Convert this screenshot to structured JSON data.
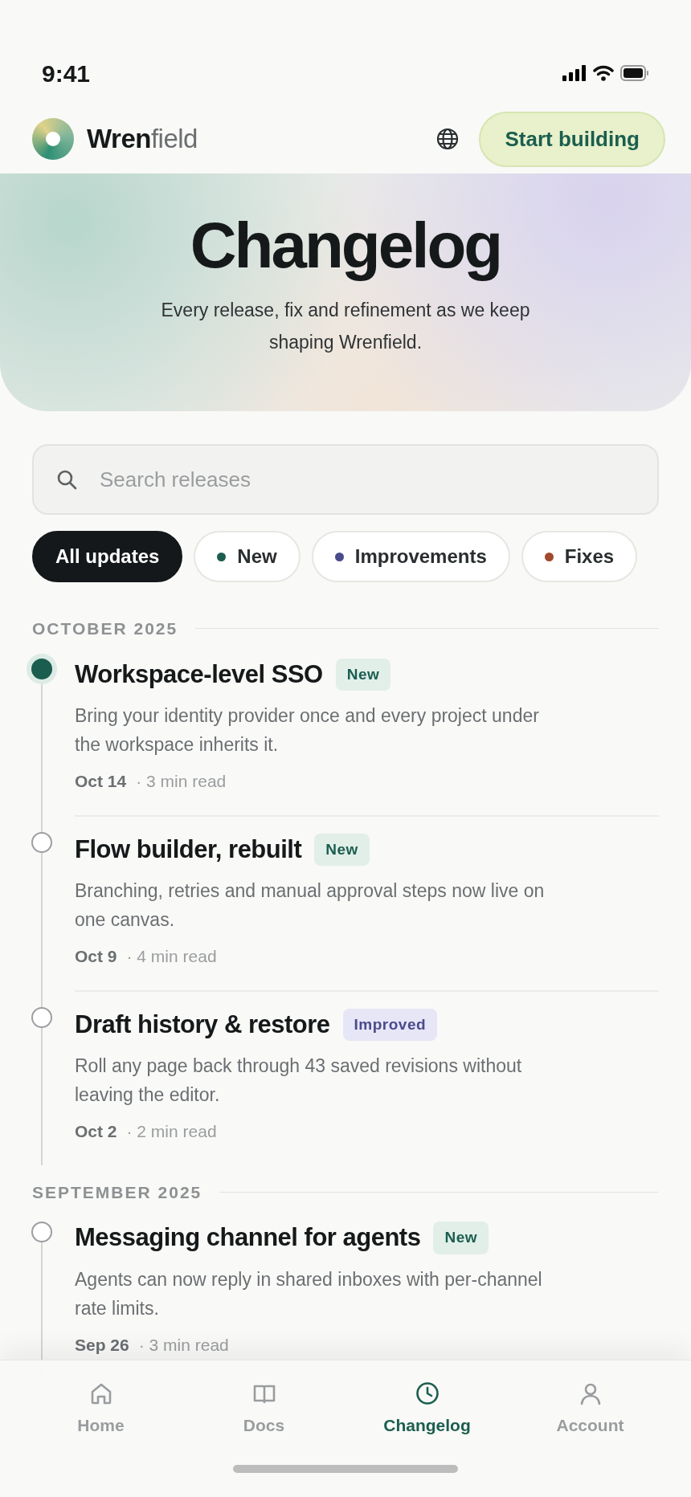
{
  "status_bar": {
    "time": "9:41"
  },
  "header": {
    "brand_bold": "Wren",
    "brand_light": "field",
    "cta": "Start building"
  },
  "hero": {
    "title": "Changelog",
    "subtitle": "Every release, fix and refinement as we keep shaping Wrenfield."
  },
  "search": {
    "placeholder": "Search releases"
  },
  "filters": [
    {
      "label": "All updates",
      "selected": true
    },
    {
      "label": "New",
      "selected": false,
      "color": "#1b5e4f"
    },
    {
      "label": "Improvements",
      "selected": false,
      "color": "#4a4b8c"
    },
    {
      "label": "Fixes",
      "selected": false,
      "color": "#a0492c"
    }
  ],
  "months": [
    {
      "label": "OCTOBER 2025",
      "entries": [
        {
          "title": "Workspace-level SSO",
          "tag": "New",
          "kind": "new",
          "current": true,
          "description": "Bring your identity provider once and every project under the workspace inherits it.",
          "date": "Oct 14",
          "read": "· 3 min read"
        },
        {
          "title": "Flow builder, rebuilt",
          "tag": "New",
          "kind": "new",
          "current": false,
          "description": "Branching, retries and manual approval steps now live on one canvas.",
          "date": "Oct 9",
          "read": "· 4 min read"
        },
        {
          "title": "Draft history & restore",
          "tag": "Improved",
          "kind": "improved",
          "current": false,
          "description": "Roll any page back through 43 saved revisions without leaving the editor.",
          "date": "Oct 2",
          "read": "· 2 min read"
        }
      ]
    },
    {
      "label": "SEPTEMBER 2025",
      "entries": [
        {
          "title": "Messaging channel for agents",
          "tag": "New",
          "kind": "new",
          "current": false,
          "description": "Agents can now reply in shared inboxes with per-channel rate limits.",
          "date": "Sep 26",
          "read": "· 3 min read"
        }
      ]
    }
  ],
  "tab_bar": [
    {
      "label": "Home",
      "selected": false
    },
    {
      "label": "Docs",
      "selected": false
    },
    {
      "label": "Changelog",
      "selected": true
    },
    {
      "label": "Account",
      "selected": false
    }
  ]
}
